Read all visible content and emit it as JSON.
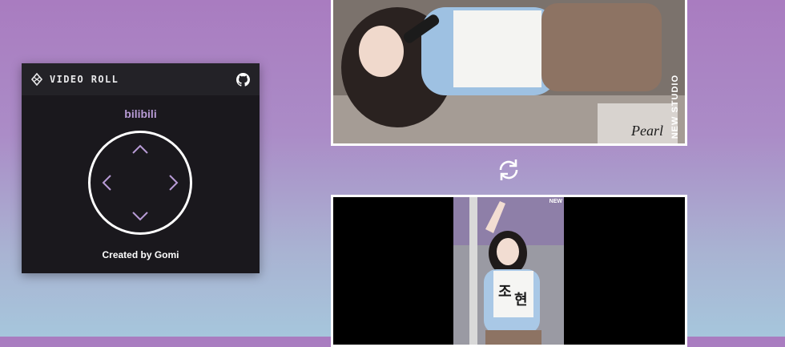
{
  "popup": {
    "title": "VIDEO ROLL",
    "site": "bilibili",
    "credit": "Created by Gomi",
    "icons": {
      "logo": "diamond-logo-icon",
      "github": "github-icon",
      "up": "chevron-up-icon",
      "down": "chevron-down-icon",
      "left": "chevron-left-icon",
      "right": "chevron-right-icon"
    }
  },
  "videos": {
    "top": {
      "watermark": "NEW STUDIO",
      "brand": "Pearl"
    },
    "bottom": {
      "watermark": "NEW"
    }
  },
  "rotate_icon": "rotate-arrows-icon",
  "colors": {
    "accent": "#b89bd6",
    "popup_bg": "#1a181d",
    "header_bg": "#232227",
    "dpad_arrow": "#b89bd6"
  }
}
